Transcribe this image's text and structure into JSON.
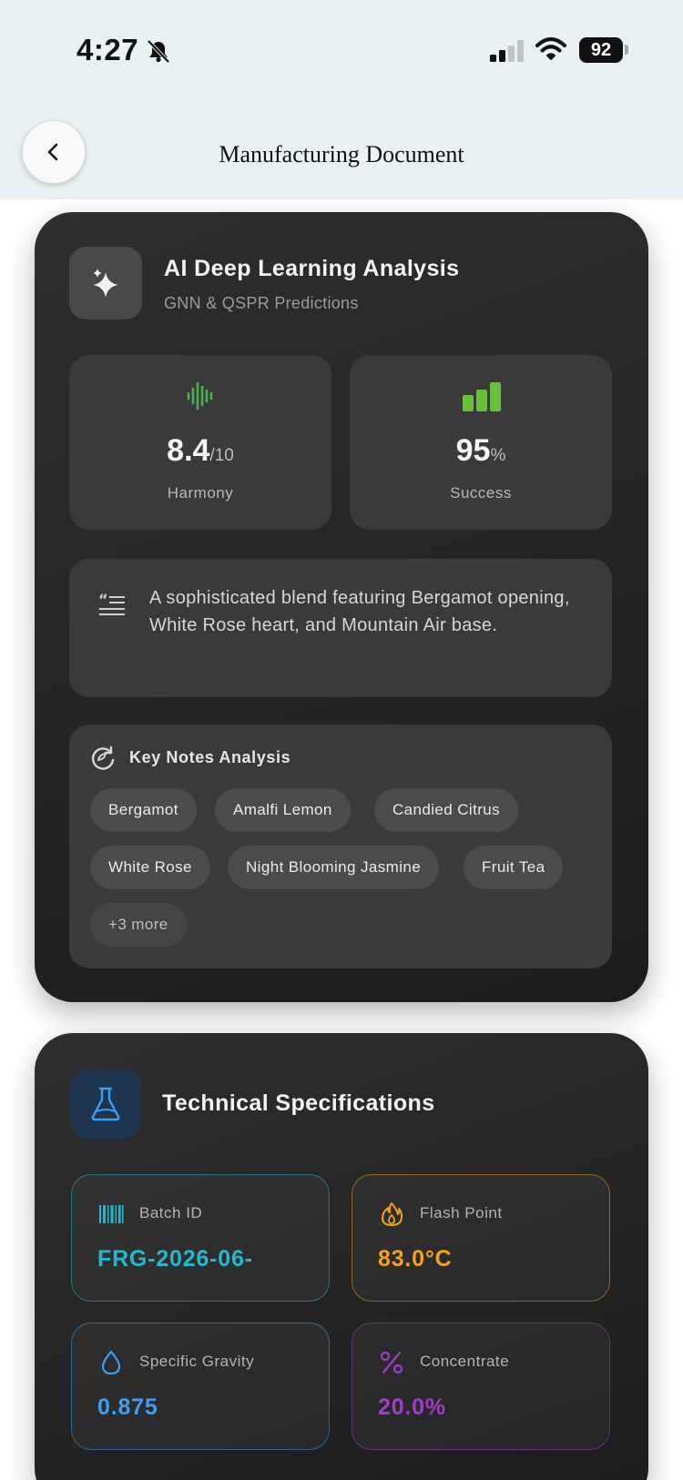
{
  "status_bar": {
    "time": "4:27",
    "battery": "92"
  },
  "header": {
    "title": "Manufacturing Document"
  },
  "ai_card": {
    "title": "AI Deep Learning Analysis",
    "subtitle": "GNN & QSPR Predictions",
    "metrics": [
      {
        "value": "8.4",
        "unit": "/10",
        "label": "Harmony",
        "color": "#4caf50"
      },
      {
        "value": "95",
        "unit": "%",
        "label": "Success",
        "color": "#6abf3a"
      }
    ],
    "description": "A sophisticated blend featuring Bergamot opening, White Rose heart, and Mountain Air base.",
    "key_notes": {
      "title": "Key Notes Analysis",
      "chips": [
        "Bergamot",
        "Amalfi Lemon",
        "Candied Citrus",
        "White Rose",
        "Night Blooming Jasmine",
        "Fruit Tea"
      ],
      "more": "+3 more"
    }
  },
  "tech_card": {
    "title": "Technical Specifications",
    "specs": [
      {
        "label": "Batch ID",
        "value": "FRG-2026-06-",
        "color": "#22b8cf",
        "icon": "barcode-icon"
      },
      {
        "label": "Flash Point",
        "value": "83.0°C",
        "color": "#f5a11a",
        "icon": "flame-icon"
      },
      {
        "label": "Specific Gravity",
        "value": "0.875",
        "color": "#3a9ff0",
        "icon": "droplet-icon"
      },
      {
        "label": "Concentrate",
        "value": "20.0%",
        "color": "#a23cc8",
        "icon": "percent-icon"
      }
    ]
  }
}
